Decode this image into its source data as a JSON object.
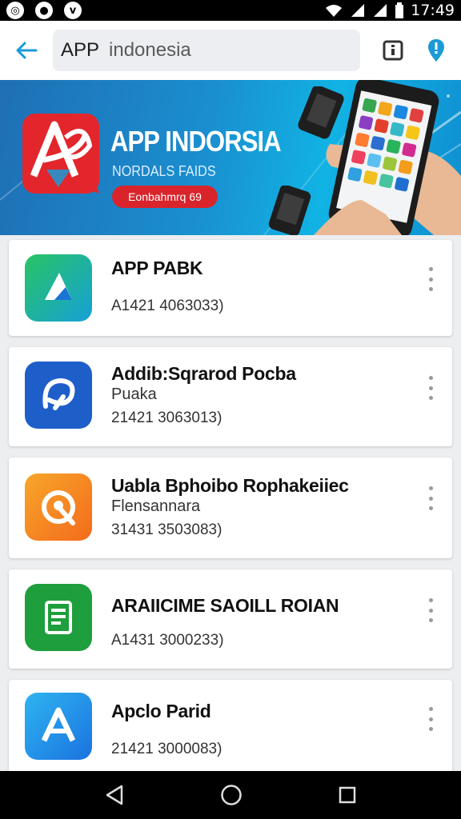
{
  "status_bar": {
    "time": "17:49",
    "left_icons": [
      "whatsapp-icon",
      "chat-bubble-icon",
      "vine-icon"
    ],
    "right_icons": [
      "wifi-icon",
      "signal-icon",
      "signal-icon",
      "battery-icon"
    ]
  },
  "toolbar": {
    "back_icon": "arrow-left-icon",
    "search_query_1": "APP",
    "search_query_2": "indonesia",
    "action_icons": [
      "info-square-icon",
      "notification-pin-icon"
    ],
    "accent": "#1a9bd7"
  },
  "banner": {
    "title": "APP INDORSIA",
    "subtitle": "NORDALS FAIDS",
    "pill": "Eonbahmrq 69",
    "logo_letter": "A"
  },
  "apps": [
    {
      "name": "APP PABK",
      "developer": "",
      "meta": "A1421 4063033)",
      "icon": "play-arrow-icon",
      "color": "#1cb25a"
    },
    {
      "name": "Addib:Sqrarod Pocba",
      "developer": "Puaka",
      "meta": "21421 3063013)",
      "icon": "swirl-logo-icon",
      "color": "#1e5ec9"
    },
    {
      "name": "Uabla Bphoibo Rophakeiiec",
      "developer": "Flensannara",
      "meta": "31431 3503083)",
      "icon": "chat-bubble-icon",
      "color": "#f58a1f"
    },
    {
      "name": "ARAIICIME SAOILL ROIAN",
      "developer": "",
      "meta": "A1431 3000233)",
      "icon": "document-icon",
      "color": "#1e9e3c"
    },
    {
      "name": "Apclo Parid",
      "developer": "",
      "meta": "21421 3000083)",
      "icon": "letter-a-icon",
      "color": "#1d8de8"
    }
  ],
  "nav_bar": {
    "icons": [
      "back-triangle-icon",
      "home-circle-icon",
      "recents-square-icon"
    ]
  }
}
